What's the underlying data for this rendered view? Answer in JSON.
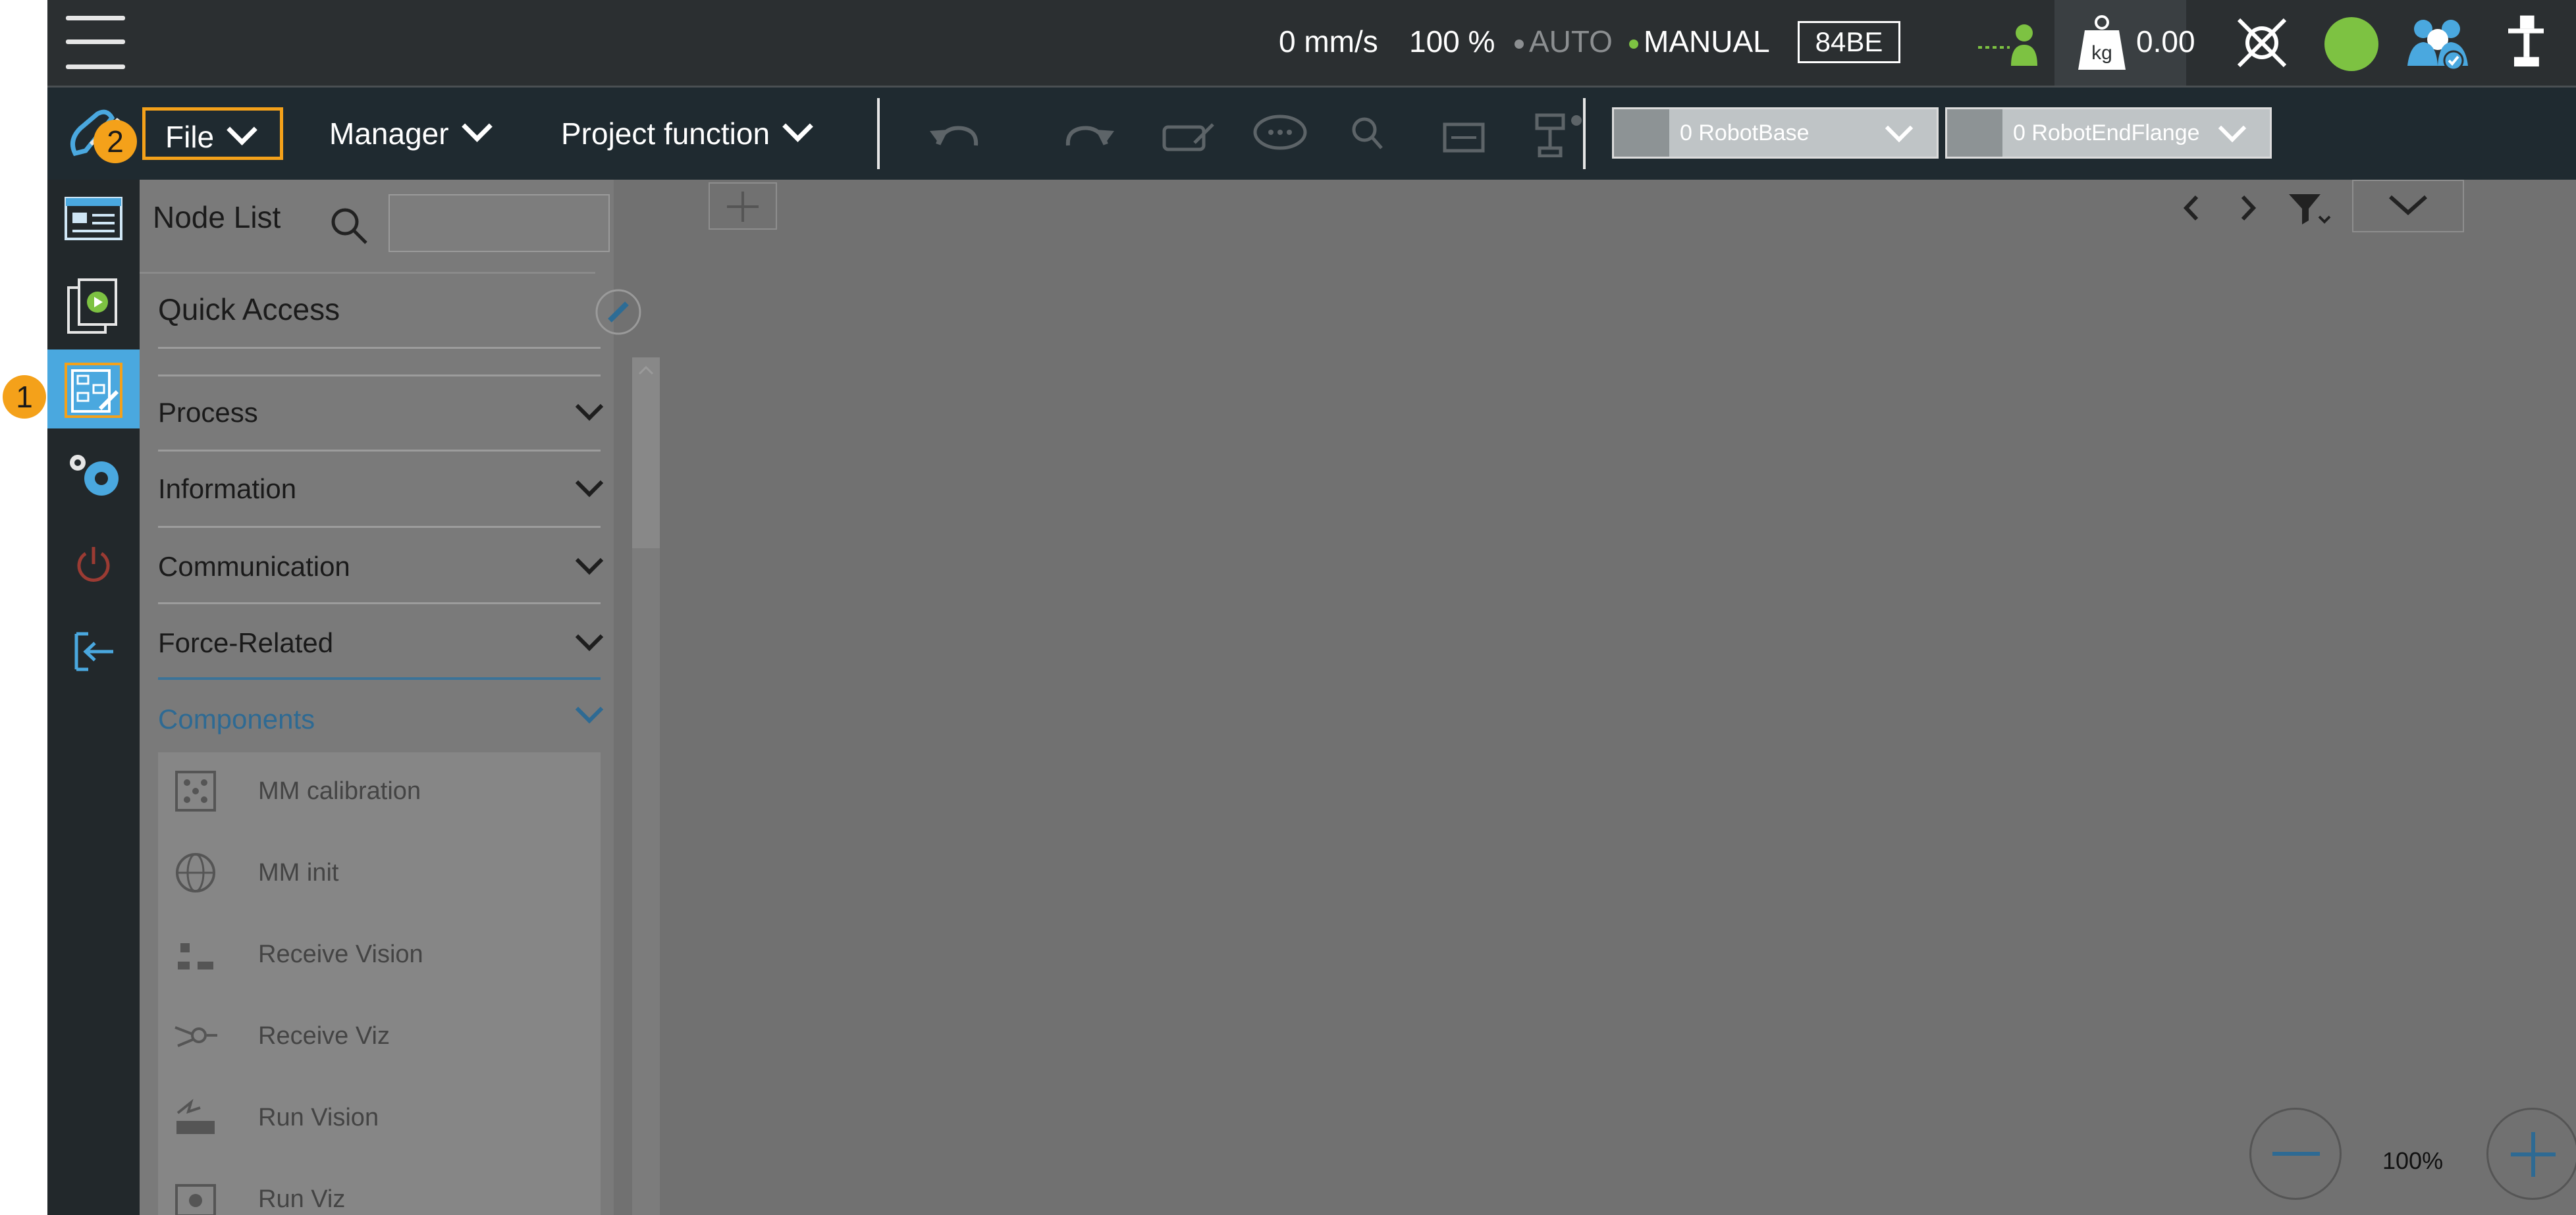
{
  "topbar": {
    "speed": "0 mm/s",
    "percent": "100 %",
    "mode_auto": "AUTO",
    "mode_manual": "MANUAL",
    "controller_id": "84BE",
    "payload_value": "0.00",
    "payload_unit": "kg",
    "colors": {
      "accent_green": "#7dc242",
      "status_green": "#7dc242",
      "user_blue": "#4aa8df"
    }
  },
  "menubar": {
    "file_label": "File",
    "manager_label": "Manager",
    "project_function_label": "Project function",
    "base_dropdown": "0 RobotBase",
    "tool_dropdown": "0 RobotEndFlange"
  },
  "callouts": {
    "one": "1",
    "two": "2"
  },
  "node_panel": {
    "title": "Node List",
    "quick_access": "Quick Access",
    "categories": [
      {
        "label": "Process"
      },
      {
        "label": "Information"
      },
      {
        "label": "Communication"
      },
      {
        "label": "Force-Related"
      },
      {
        "label": "Components"
      }
    ],
    "components": [
      {
        "label": "MM calibration",
        "icon": "grid-dots-icon"
      },
      {
        "label": "MM init",
        "icon": "globe-icon"
      },
      {
        "label": "Receive Vision",
        "icon": "vision-receive-icon"
      },
      {
        "label": "Receive Viz",
        "icon": "viz-receive-icon"
      },
      {
        "label": "Run Vision",
        "icon": "vision-run-icon"
      },
      {
        "label": "Run Viz",
        "icon": "viz-run-icon"
      }
    ]
  },
  "canvas": {
    "zoom": "100%"
  }
}
